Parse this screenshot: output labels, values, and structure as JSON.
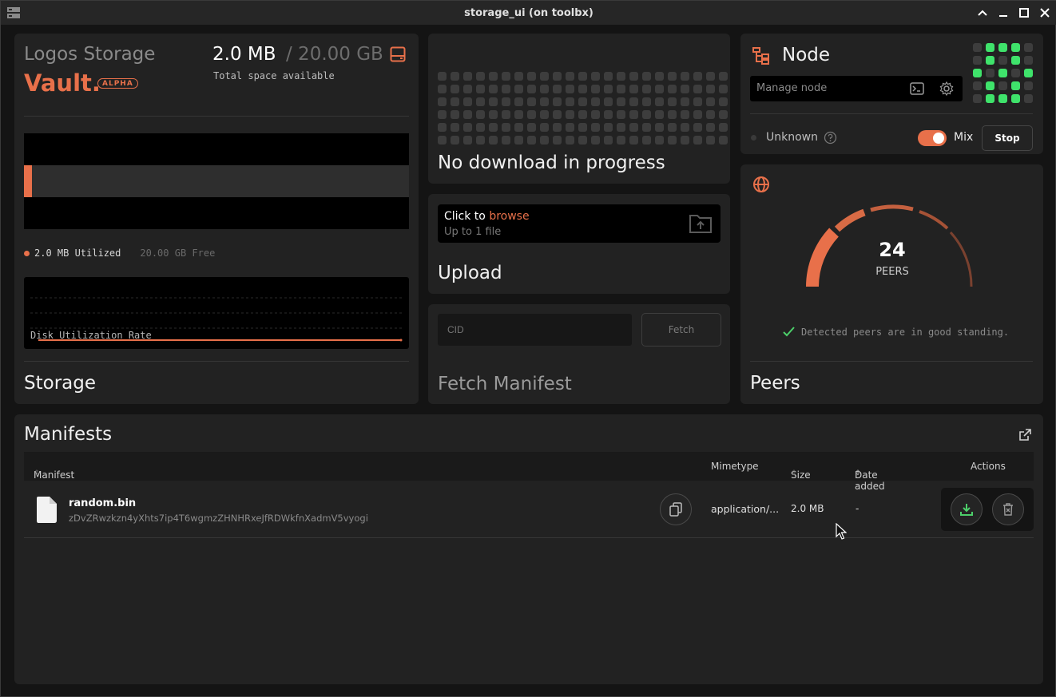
{
  "window": {
    "title": "storage_ui (on toolbx)"
  },
  "storage": {
    "brand_line1": "Logos Storage",
    "brand_line2": "Vault.",
    "badge": "ALPHA",
    "used": "2.0 MB",
    "total": "/ 20.00 GB",
    "subtitle": "Total space available",
    "utilized_label": "2.0 MB Utilized",
    "free_label": "20.00 GB Free",
    "utilized_fraction": 0.0001,
    "chart_label": "Disk Utilization Rate",
    "title": "Storage"
  },
  "download": {
    "status": "No download in progress"
  },
  "upload": {
    "click_to": "Click to",
    "browse": "browse",
    "limit": "Up to 1 file",
    "title": "Upload"
  },
  "fetch": {
    "placeholder": "CID",
    "button": "Fetch",
    "title": "Fetch Manifest"
  },
  "node": {
    "title": "Node",
    "manage_placeholder": "Manage node",
    "status": "Unknown",
    "mix_label": "Mix",
    "mix_enabled": true,
    "stop_button": "Stop"
  },
  "peers": {
    "count": "24",
    "count_label": "PEERS",
    "status": "Detected peers are in good standing.",
    "title": "Peers"
  },
  "manifests": {
    "title": "Manifests",
    "columns": {
      "manifest": "Manifest",
      "mimetype": "Mimetype",
      "size": "Size",
      "date_added": "Date added",
      "actions": "Actions"
    },
    "rows": [
      {
        "name": "random.bin",
        "cid": "zDvZRwzkzn4yXhts7ip4T6wgmzZHNHRxeJfRDWkfnXadmV5vyogi",
        "mimetype": "application/...",
        "size": "2.0 MB",
        "date_added": "-"
      }
    ]
  },
  "colors": {
    "accent": "#e8704a",
    "led_on": "#3fe36b",
    "led_off": "#3d3d3d",
    "ok": "#4ccf6a"
  }
}
